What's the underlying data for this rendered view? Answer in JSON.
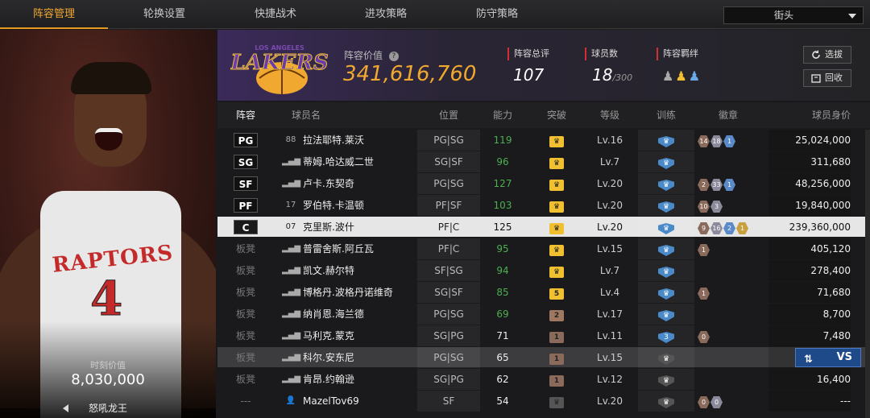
{
  "tabs": [
    "阵容管理",
    "轮换设置",
    "快捷战术",
    "进攻策略",
    "防守策略"
  ],
  "active_tab": 0,
  "mode_dropdown": "街头",
  "player_card": {
    "jersey_word": "RAPTORS",
    "jersey_number": "4",
    "value_label": "时刻价值",
    "value": "8,030,000",
    "name": "怒吼龙王"
  },
  "team": {
    "logo_text": "LAKERS",
    "logo_subtext": "LOS ANGELES",
    "value_label": "阵容价值",
    "value": "341,616,760",
    "rating_label": "阵容总评",
    "rating": "107",
    "count_label": "球员数",
    "count": "18",
    "count_max": "/300",
    "synergy_label": "阵容羁绊",
    "buttons": {
      "select": "选拔",
      "recycle": "回收"
    }
  },
  "table": {
    "headers": [
      "阵容",
      "球员名",
      "位置",
      "能力",
      "突破",
      "等级",
      "训练",
      "徽章",
      "球员身价"
    ],
    "rows": [
      {
        "pos": "PG",
        "num": "88",
        "name": "拉法耶特.莱沃",
        "role": "PG|SG",
        "ability": "119",
        "break": "",
        "level": "Lv.16",
        "train": "",
        "badges": [
          "14",
          "18",
          "1"
        ],
        "value": "25,024,000"
      },
      {
        "pos": "SG",
        "num": "",
        "name": "蒂姆.哈达威二世",
        "role": "SG|SF",
        "ability": "96",
        "break": "",
        "level": "Lv.7",
        "train": "",
        "badges": [],
        "value": "311,680"
      },
      {
        "pos": "SF",
        "num": "",
        "name": "卢卡.东契奇",
        "role": "PG|SG",
        "ability": "127",
        "break": "",
        "level": "Lv.20",
        "train": "",
        "badges": [
          "2",
          "33",
          "1"
        ],
        "value": "48,256,000"
      },
      {
        "pos": "PF",
        "num": "17",
        "name": "罗伯特.卡温顿",
        "role": "PF|SF",
        "ability": "103",
        "break": "",
        "level": "Lv.20",
        "train": "",
        "badges": [
          "10",
          "3"
        ],
        "value": "19,840,000"
      },
      {
        "pos": "C",
        "num": "07",
        "name": "克里斯.波什",
        "role": "PF|C",
        "ability": "125",
        "break": "",
        "level": "Lv.20",
        "train": "",
        "badges": [
          "9",
          "16",
          "2",
          "1"
        ],
        "value": "239,360,000"
      },
      {
        "pos": "板凳",
        "num": "",
        "name": "普雷舍斯.阿丘瓦",
        "role": "PF|C",
        "ability": "95",
        "break": "",
        "level": "Lv.15",
        "train": "",
        "badges": [
          "1"
        ],
        "value": "405,120"
      },
      {
        "pos": "板凳",
        "num": "",
        "name": "凯文.赫尔特",
        "role": "SF|SG",
        "ability": "94",
        "break": "",
        "level": "Lv.7",
        "train": "",
        "badges": [],
        "value": "278,400"
      },
      {
        "pos": "板凳",
        "num": "",
        "name": "博格丹.波格丹诺维奇",
        "role": "SG|SF",
        "ability": "85",
        "break": "5",
        "level": "Lv.4",
        "train": "",
        "badges": [
          "1"
        ],
        "value": "71,680"
      },
      {
        "pos": "板凳",
        "num": "",
        "name": "纳肖恩.海兰德",
        "role": "PG|SG",
        "ability": "69",
        "break": "2",
        "level": "Lv.17",
        "train": "",
        "badges": [],
        "value": "8,700"
      },
      {
        "pos": "板凳",
        "num": "",
        "name": "马利克.蒙克",
        "role": "SG|PG",
        "ability": "71",
        "break": "1",
        "level": "Lv.11",
        "train": "3",
        "badges": [
          "0"
        ],
        "value": "7,480"
      },
      {
        "pos": "板凳",
        "num": "",
        "name": "科尔.安东尼",
        "role": "PG|SG",
        "ability": "65",
        "break": "1",
        "level": "Lv.15",
        "train": "",
        "badges": [],
        "value": ""
      },
      {
        "pos": "板凳",
        "num": "",
        "name": "肯昂.约翰逊",
        "role": "SG|PG",
        "ability": "62",
        "break": "1",
        "level": "Lv.12",
        "train": "",
        "badges": [],
        "value": "16,400"
      },
      {
        "pos": "---",
        "num": "",
        "name": "MazelTov69",
        "role": "SF",
        "ability": "54",
        "break": "",
        "level": "Lv.20",
        "train": "",
        "badges": [
          "0",
          "0"
        ],
        "value": "---"
      }
    ]
  },
  "vs_button": "VS",
  "colors": {
    "accent": "#f0a830",
    "green": "#4caf50",
    "badge_gold": "#f0c030",
    "badge_blue": "#4a8ac8"
  }
}
